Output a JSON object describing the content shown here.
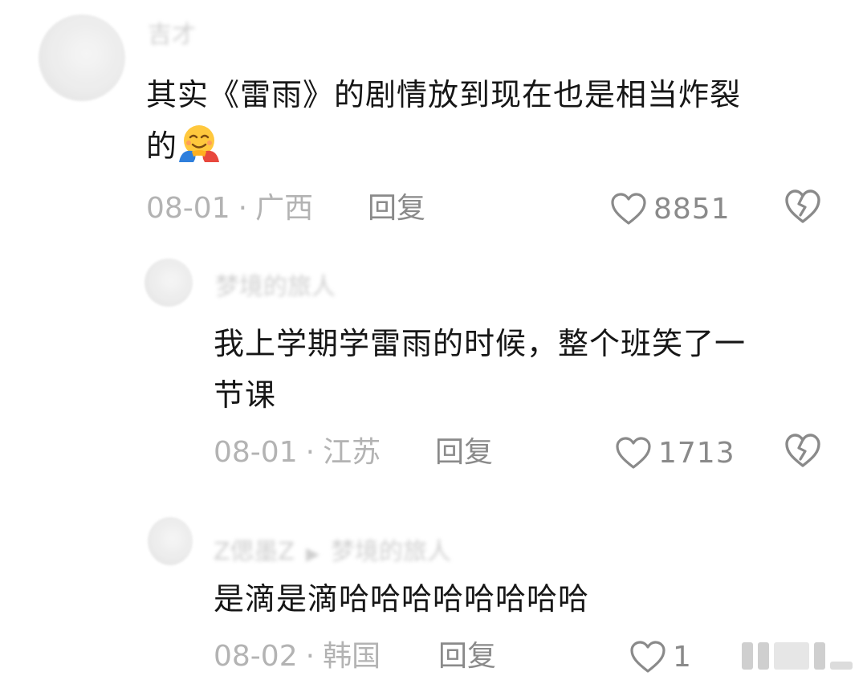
{
  "comments": [
    {
      "username": "吉才",
      "text_line1": "其实《雷雨》的剧情放到现在也是相当炸裂",
      "text_line2": "的",
      "emoji": "hugging-face-emoji",
      "date": "08-01",
      "location": "广西",
      "reply_label": "回复",
      "likes": "8851"
    },
    {
      "username": "梦境的旅人",
      "text_line1": "我上学期学雷雨的时候，整个班笑了一",
      "text_line2": "节课",
      "date": "08-01",
      "location": "江苏",
      "reply_label": "回复",
      "likes": "1713"
    },
    {
      "username": "Z偲墨Z",
      "reply_to": "梦境的旅人",
      "text_line1": "是滴是滴哈哈哈哈哈哈哈哈",
      "date": "08-02",
      "location": "韩国",
      "reply_label": "回复",
      "likes": "1"
    }
  ],
  "separator": "·",
  "colors": {
    "text": "#161616",
    "meta": "#b3b3b3",
    "action": "#8a8a8a"
  }
}
